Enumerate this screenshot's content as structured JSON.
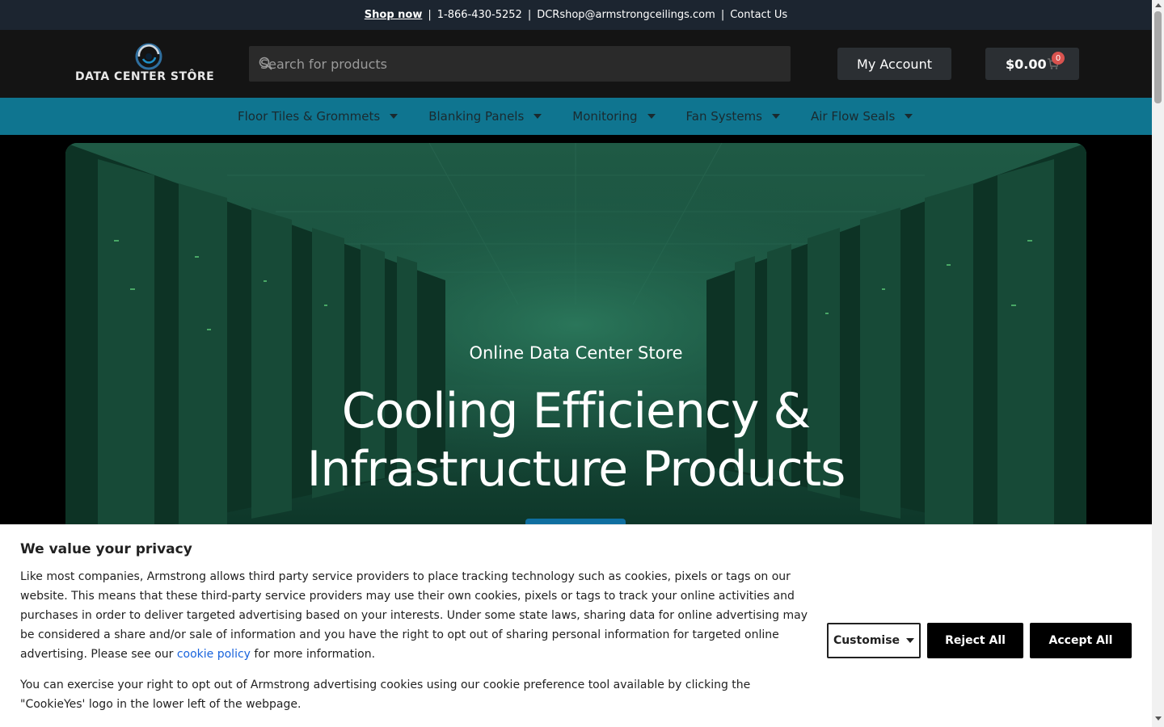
{
  "topbar": {
    "shop_now": "Shop now",
    "phone": "1-866-430-5252",
    "email": "DCRshop@armstrongceilings.com",
    "contact": "Contact Us",
    "separator": "|"
  },
  "header": {
    "logo_text": "DATA CENTER STÔRE",
    "search_placeholder": "Search for products",
    "account_label": "My Account",
    "cart_total": "$0.00",
    "cart_count": "0"
  },
  "nav": {
    "items": [
      {
        "label": "Floor Tiles & Grommets"
      },
      {
        "label": "Blanking Panels"
      },
      {
        "label": "Monitoring"
      },
      {
        "label": "Fan Systems"
      },
      {
        "label": "Air Flow Seals"
      }
    ]
  },
  "hero": {
    "subtitle": "Online Data Center Store",
    "title_line1": "Cooling Efficiency &",
    "title_line2": "Infrastructure Products"
  },
  "cookie": {
    "heading": "We value your privacy",
    "p1_before_link": "Like most companies, Armstrong allows third party service providers to place tracking technology such as cookies, pixels or tags on our website.  This means that these third-party service providers may use their own cookies, pixels or tags to track your online activities and purchases in order to deliver targeted advertising based on your interests.  Under some state laws, sharing data for online advertising may be considered a share and/or sale of information and you have the right to opt out of sharing personal information for targeted online advertising. Please see our ",
    "link_text": "cookie policy",
    "p1_after_link": " for more information.",
    "p2": "You can exercise your right to opt out of Armstrong advertising cookies using our cookie preference tool available by clicking the \"CookieYes' logo in the lower left of the webpage.",
    "customise_label": "Customise",
    "reject_label": "Reject All",
    "accept_label": "Accept All"
  },
  "colors": {
    "topbar_bg": "#1c2530",
    "header_bg": "#141414",
    "nav_bg": "#0f7590",
    "accent_blue": "#0f6fa0",
    "cart_badge": "#d9534f"
  },
  "icons": [
    "logo-swirl-icon",
    "search-icon",
    "cart-icon",
    "caret-down-icon"
  ]
}
